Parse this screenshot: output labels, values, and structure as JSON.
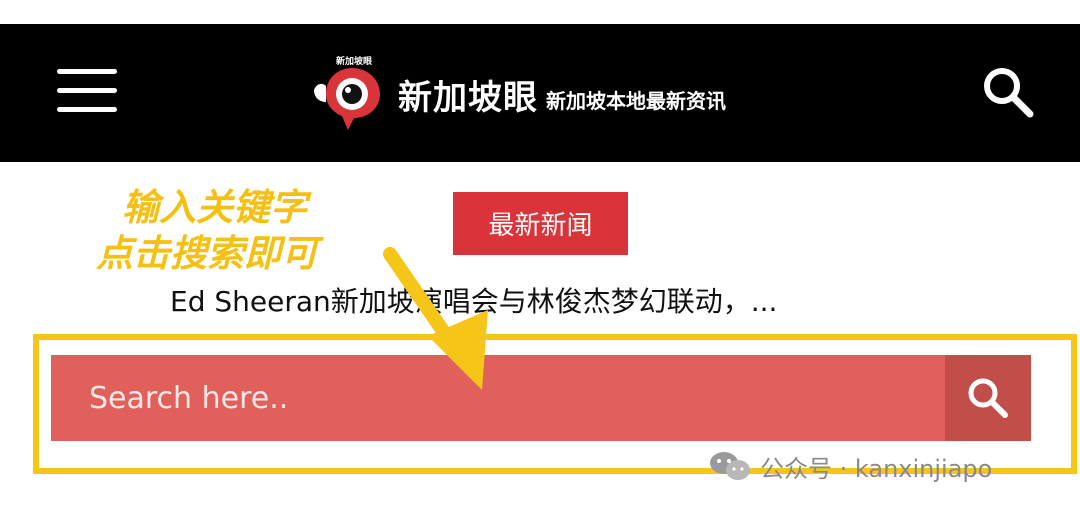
{
  "header": {
    "logo_text": "新加坡眼",
    "brand_name": "新加坡眼",
    "tagline": "新加坡本地最新资讯",
    "menu_icon": "hamburger-menu-icon",
    "search_icon": "search-icon"
  },
  "news": {
    "badge_label": "最新新闻",
    "headline": "Ed Sheeran新加坡演唱会与林俊杰梦幻联动，..."
  },
  "annotation": {
    "line1": "输入关键字",
    "line2": "点击搜索即可"
  },
  "search": {
    "placeholder": "Search here..",
    "value": "",
    "submit_icon": "search-icon"
  },
  "watermark": {
    "text": "公众号 · kanxinjiapo",
    "icon": "wechat-icon"
  },
  "colors": {
    "header_bg": "#000000",
    "badge_red": "#d9343a",
    "search_bar": "#e0605b",
    "search_button": "#c24e4a",
    "highlight": "#f5c518",
    "annotation_text": "#f5c012"
  }
}
